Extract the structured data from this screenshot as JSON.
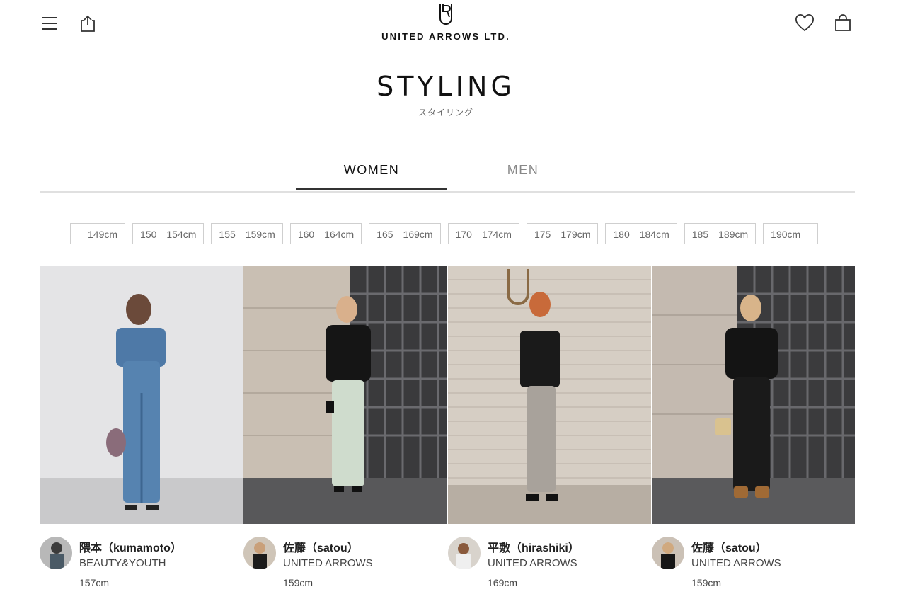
{
  "header": {
    "menu_icon": "hamburger-menu-icon",
    "share_icon": "share-icon",
    "logo_text": "UNITED ARROWS LTD.",
    "favorite_icon": "heart-icon",
    "cart_icon": "shopping-bag-icon"
  },
  "page": {
    "title": "STYLING",
    "subtitle": "スタイリング"
  },
  "tabs": [
    {
      "label": "WOMEN",
      "active": true
    },
    {
      "label": "MEN",
      "active": false
    }
  ],
  "height_filters": [
    "－149cm",
    "150－154cm",
    "155－159cm",
    "160－164cm",
    "165－169cm",
    "170－174cm",
    "175－179cm",
    "180－184cm",
    "185－189cm",
    "190cm－"
  ],
  "stylings": [
    {
      "name": "隈本（kumamoto）",
      "brand": "BEAUTY&YOUTH",
      "height": "157cm"
    },
    {
      "name": "佐藤（satou）",
      "brand": "UNITED ARROWS",
      "height": "159cm"
    },
    {
      "name": "平敷（hirashiki）",
      "brand": "UNITED ARROWS",
      "height": "169cm"
    },
    {
      "name": "佐藤（satou）",
      "brand": "UNITED ARROWS",
      "height": "159cm"
    }
  ],
  "colors": {
    "text": "#222222",
    "tab_underline": "#333333",
    "chip_border": "#cfcfcf"
  }
}
